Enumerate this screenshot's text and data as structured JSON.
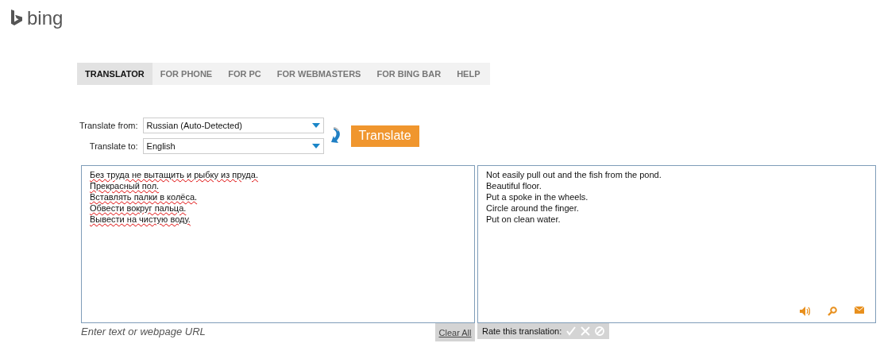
{
  "logo": {
    "text": "bing"
  },
  "nav": [
    {
      "label": "TRANSLATOR",
      "selected": true
    },
    {
      "label": "FOR PHONE",
      "selected": false
    },
    {
      "label": "FOR PC",
      "selected": false
    },
    {
      "label": "FOR WEBMASTERS",
      "selected": false
    },
    {
      "label": "FOR BING BAR",
      "selected": false
    },
    {
      "label": "HELP",
      "selected": false
    }
  ],
  "from": {
    "label": "Translate from:",
    "value": "Russian (Auto-Detected)"
  },
  "to": {
    "label": "Translate to:",
    "value": "English"
  },
  "translate_button": "Translate",
  "source_lines": [
    "Без труда не вытащить и рыбку из пруда.",
    "Прекрасный пол.",
    "Вставлять палки в колёса.",
    "Обвести вокруг пальца.",
    "Вывести на чистую воду."
  ],
  "output_lines": [
    "Not easily pull out and the fish from the pond.",
    "Beautiful floor.",
    "Put a spoke in the wheels.",
    "Circle around the finger.",
    "Put on clean water."
  ],
  "hint": "Enter text or webpage URL",
  "clear_all": "Clear All",
  "rate_label": "Rate this translation:"
}
